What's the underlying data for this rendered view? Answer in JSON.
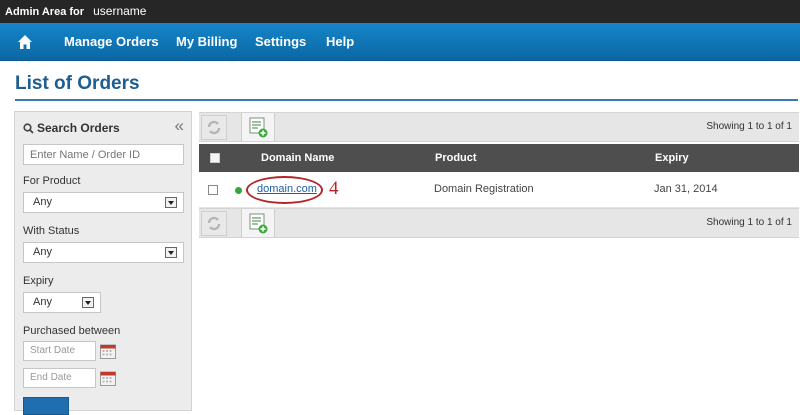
{
  "topbar": {
    "label": "Admin Area for",
    "username": "username"
  },
  "nav": {
    "home_icon": "home-icon",
    "items": [
      "Manage Orders",
      "My Billing",
      "Settings",
      "Help"
    ]
  },
  "page": {
    "title": "List of Orders"
  },
  "sidebar": {
    "title": "Search Orders",
    "collapse_glyph": "«",
    "search_placeholder": "Enter Name / Order ID",
    "product_label": "For Product",
    "product_value": "Any",
    "status_label": "With Status",
    "status_value": "Any",
    "expiry_label": "Expiry",
    "expiry_value": "Any",
    "purchased_label": "Purchased between",
    "start_placeholder": "Start Date",
    "end_placeholder": "End Date"
  },
  "grid": {
    "showing_top": "Showing 1 to 1 of 1",
    "showing_bottom": "Showing 1 to 1 of 1",
    "columns": [
      "Domain Name",
      "Product",
      "Expiry"
    ],
    "rows": [
      {
        "domain": "domain.com",
        "product": "Domain Registration",
        "expiry": "Jan 31, 2014",
        "status_color": "#3aa43a"
      }
    ]
  },
  "annotation": {
    "number": "4",
    "color": "#b3262a"
  },
  "colors": {
    "nav": "#0b67a4",
    "title": "#1e5d8f",
    "link": "#1a5ca6"
  }
}
